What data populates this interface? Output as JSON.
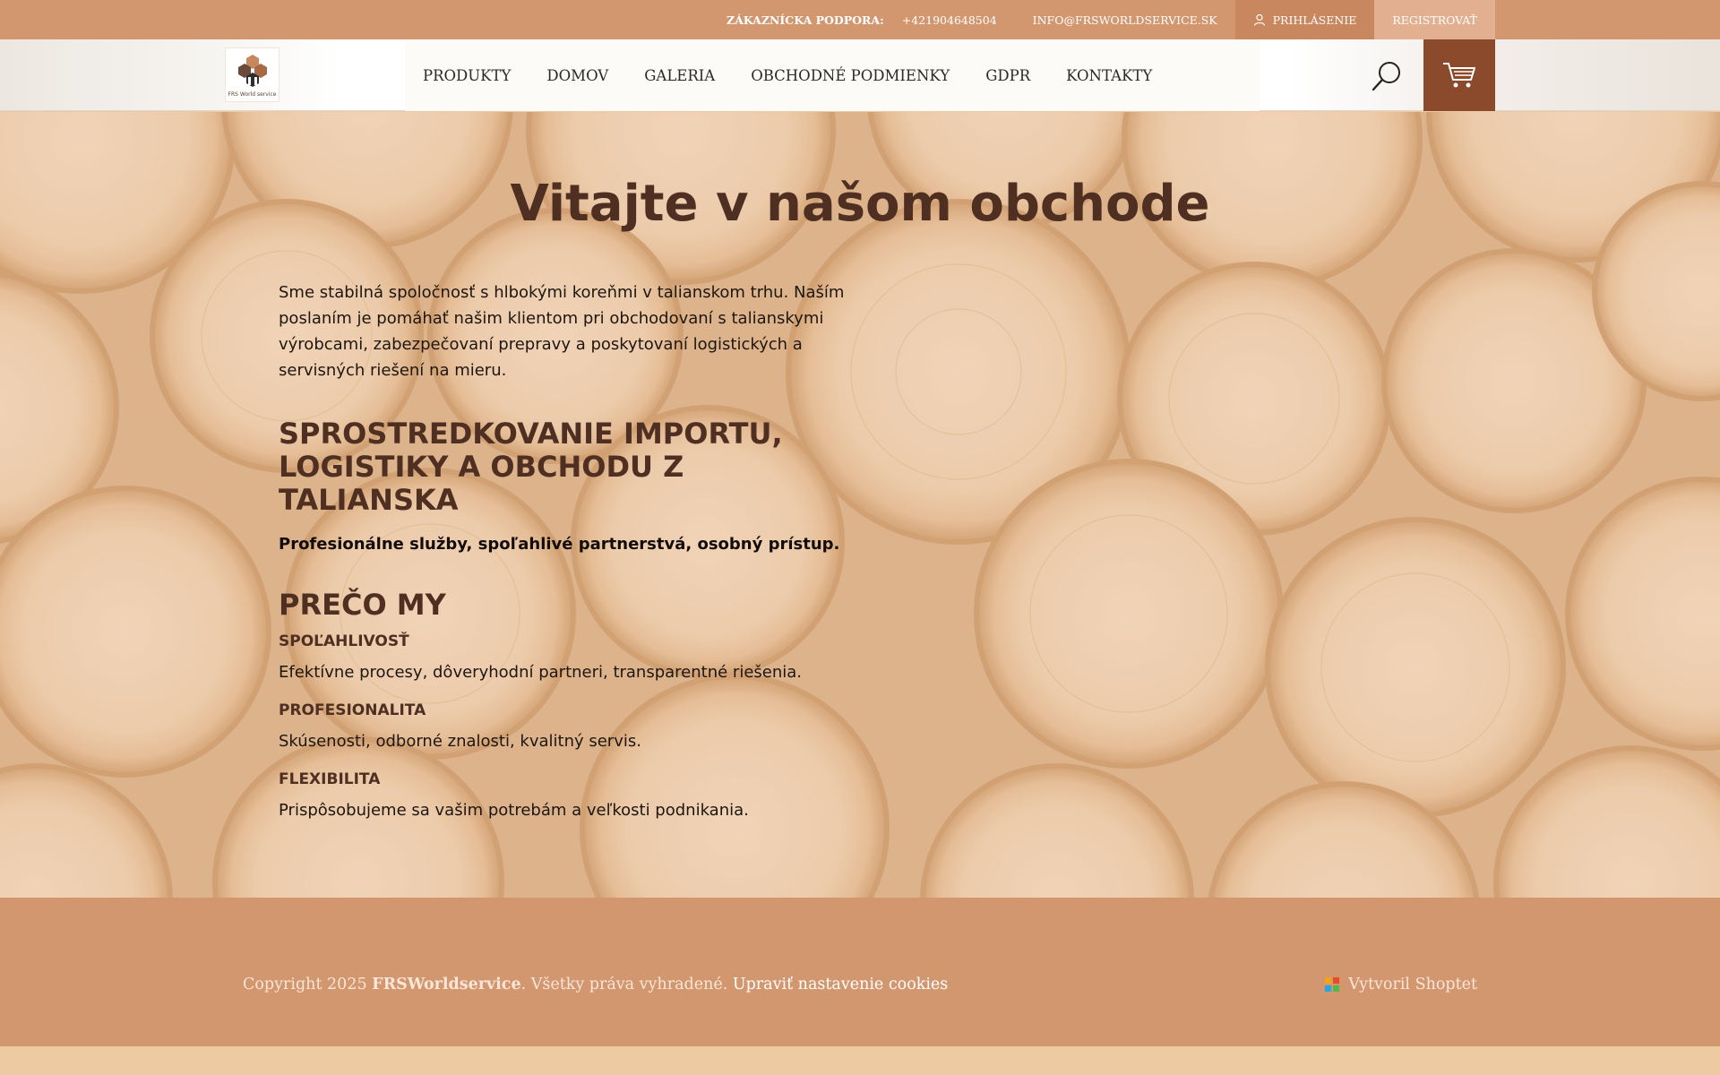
{
  "topbar": {
    "support_label": "ZÁKAZNÍCKA PODPORA:",
    "phone": "+421904648504",
    "email": "INFO@FRSWORLDSERVICE.SK",
    "login": "PRIHLÁSENIE",
    "register": "REGISTROVAŤ"
  },
  "header": {
    "logo_text": "FRS World service",
    "nav": [
      "PRODUKTY",
      "DOMOV",
      "GALERIA",
      "OBCHODNÉ PODMIENKY",
      "GDPR",
      "KONTAKTY"
    ]
  },
  "hero": {
    "title": "Vitajte v našom obchode",
    "intro": "Sme stabilná spoločnosť s hlbokými koreňmi v talianskom trhu. Naším poslaním je pomáhať našim klientom pri obchodovaní s talianskymi výrobcami, zabezpečovaní prepravy a poskytovaní logistických a servisných riešení na mieru.",
    "section_heading": "SPROSTREDKOVANIE IMPORTU, LOGISTIKY A OBCHODU Z TALIANSKA",
    "section_sub": "Profesionálne služby, spoľahlivé partnerstvá, osobný prístup.",
    "why_heading": "PREČO MY",
    "features": [
      {
        "title": "SPOĽAHLIVOSŤ",
        "text": "Efektívne procesy, dôveryhodní partneri, transparentné riešenia."
      },
      {
        "title": "PROFESIONALITA",
        "text": "Skúsenosti, odborné znalosti, kvalitný servis."
      },
      {
        "title": "FLEXIBILITA",
        "text": "Prispôsobujeme sa vašim potrebám a veľkosti podnikania."
      }
    ]
  },
  "footer": {
    "copyright_prefix": "Copyright 2025",
    "brand": "FRSWorldservice",
    "rights": ". Všetky práva vyhradené.",
    "cookies": "Upraviť nastavenie cookies",
    "shoptet": "Vytvoril Shoptet"
  },
  "colors": {
    "topbar": "#d39770",
    "accent_dark": "#8a4a2b",
    "heading": "#4e2f21",
    "footer": "#d39770"
  },
  "icons": {
    "login": "user-icon",
    "search": "search-icon",
    "cart": "cart-icon",
    "shoptet": "shoptet-logo-icon"
  }
}
